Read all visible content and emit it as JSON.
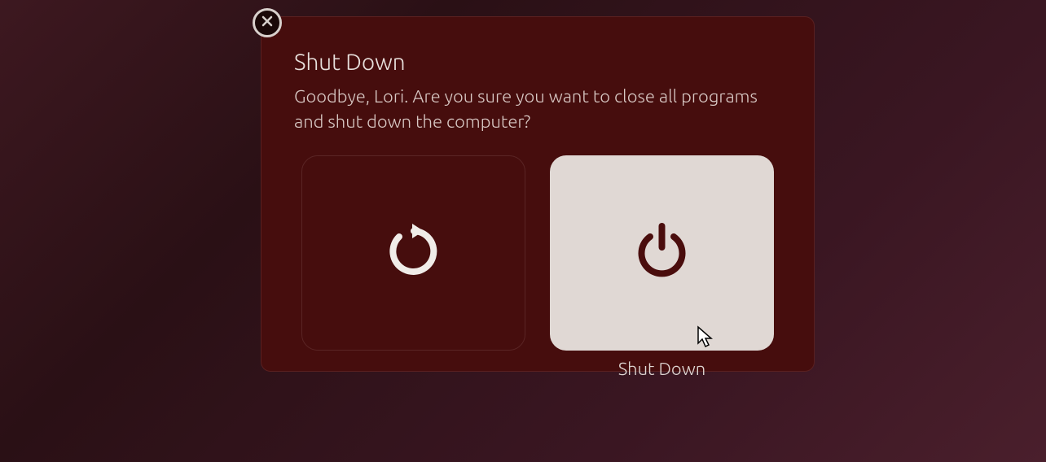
{
  "dialog": {
    "title": "Shut Down",
    "message": "Goodbye, Lori. Are you sure you want to close all programs and shut down the computer?",
    "restart_label": "",
    "shutdown_label": "Shut Down"
  },
  "colors": {
    "dialog_bg": "#460d0d",
    "text": "#e8e0dc",
    "shutdown_btn_bg": "#e0d8d4",
    "power_icon": "#4a0d0d"
  }
}
